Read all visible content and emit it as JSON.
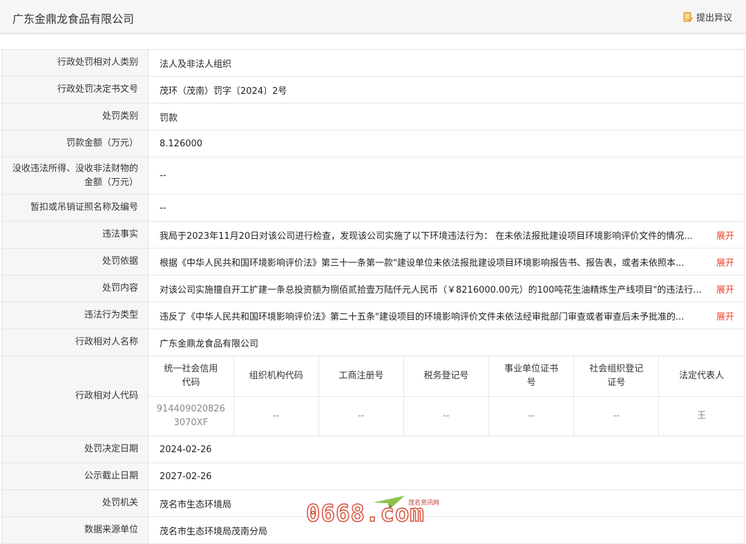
{
  "header": {
    "title": "广东金鼎龙食品有限公司",
    "objection_label": "提出异议"
  },
  "rows": {
    "r1": {
      "label": "行政处罚相对人类别",
      "value": "法人及非法人组织"
    },
    "r2": {
      "label": "行政处罚决定书文号",
      "value": "茂环（茂南）罚字〔2024〕2号"
    },
    "r3": {
      "label": "处罚类别",
      "value": "罚款"
    },
    "r4": {
      "label": "罚款金额（万元）",
      "value": "8.126000"
    },
    "r5": {
      "label_line1": "没收违法所得、没收非法财物的",
      "label_line2": "金额（万元）",
      "value": "--"
    },
    "r6": {
      "label": "暂扣或吊销证照名称及编号",
      "value": "--"
    },
    "r7": {
      "label": "违法事实",
      "value": "我局于2023年11月20日对该公司进行检查，发现该公司实施了以下环境违法行为： 在未依法报批建设项目环境影响评价文件的情况...",
      "expand": "展开"
    },
    "r8": {
      "label": "处罚依据",
      "value": "根据《中华人民共和国环境影响评价法》第三十一条第一款\"建设单位未依法报批建设项目环境影响报告书、报告表，或者未依照本...",
      "expand": "展开"
    },
    "r9": {
      "label": "处罚内容",
      "value": "对该公司实施擅自开工扩建一条总投资额为捌佰贰拾壹万陆仟元人民币（￥8216000.00元）的100吨花生油精炼生产线项目\"的违法行...",
      "expand": "展开"
    },
    "r10": {
      "label": "违法行为类型",
      "value": "违反了《中华人民共和国环境影响评价法》第二十五条\"建设项目的环境影响评价文件未依法经审批部门审查或者审查后未予批准的...",
      "expand": "展开"
    },
    "r11": {
      "label": "行政相对人名称",
      "value": "广东金鼎龙食品有限公司"
    },
    "r12": {
      "label": "行政相对人代码"
    },
    "r13": {
      "label": "处罚决定日期",
      "value": "2024-02-26"
    },
    "r14": {
      "label": "公示截止日期",
      "value": "2027-02-26"
    },
    "r15": {
      "label": "处罚机关",
      "value": "茂名市生态环境局"
    },
    "r16": {
      "label": "数据来源单位",
      "value": "茂名市生态环境局茂南分局"
    }
  },
  "codes": {
    "headers": {
      "h1a": "统一社会信用",
      "h1b": "代码",
      "h2": "组织机构代码",
      "h3": "工商注册号",
      "h4": "税务登记号",
      "h5a": "事业单位证书",
      "h5b": "号",
      "h6a": "社会组织登记",
      "h6b": "证号",
      "h7": "法定代表人"
    },
    "values": {
      "v1a": "914409020826",
      "v1b": "3070XF",
      "v2": "--",
      "v3": "--",
      "v4": "--",
      "v5": "--",
      "v6": "--",
      "v7": "王"
    }
  },
  "watermark": {
    "brand": "0668.com",
    "sub": "茂名资讯网"
  }
}
